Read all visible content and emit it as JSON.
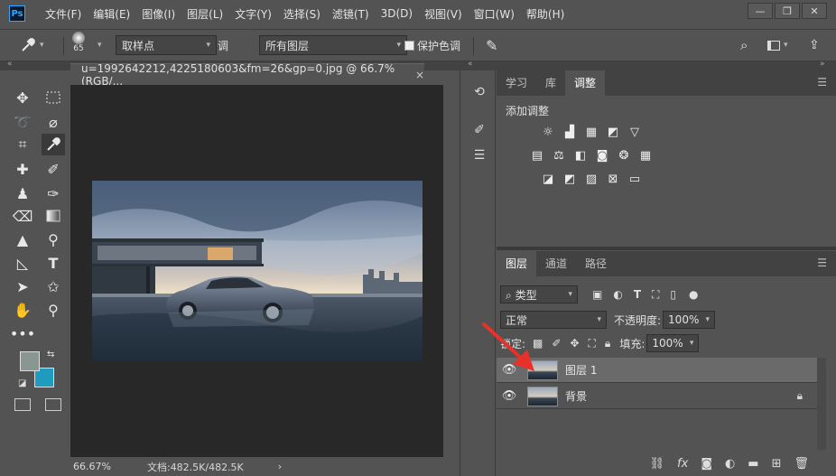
{
  "app": {
    "logo_text": "Ps"
  },
  "menu": [
    "文件(F)",
    "编辑(E)",
    "图像(I)",
    "图层(L)",
    "文字(Y)",
    "选择(S)",
    "滤镜(T)",
    "3D(D)",
    "视图(V)",
    "窗口(W)",
    "帮助(H)"
  ],
  "window_controls": {
    "minimize": "—",
    "restore": "❐",
    "close": "✕"
  },
  "options_bar": {
    "brush_size": "65",
    "sample_label": "取样点",
    "sample_value_tail": "调",
    "layers_select": "所有图层",
    "protect_label": "保护色调"
  },
  "document": {
    "tab_title": "u=1992642212,4225180603&fm=26&gp=0.jpg @ 66.7%(RGB/...",
    "close": "×",
    "zoom": "66.67%",
    "doc_info": "文档:482.5K/482.5K",
    "status_arrow": "›"
  },
  "panels_top": {
    "tabs": [
      "学习",
      "库",
      "调整"
    ],
    "active": "调整",
    "heading": "添加调整"
  },
  "panels_layers": {
    "tabs": [
      "图层",
      "通道",
      "路径"
    ],
    "active": "图层",
    "filter_kind": "类型",
    "blend_mode": "正常",
    "opacity_label": "不透明度:",
    "opacity_value": "100%",
    "lock_label": "锁定:",
    "fill_label": "填充:",
    "fill_value": "100%",
    "layers": [
      {
        "name": "图层 1",
        "selected": true,
        "locked": false
      },
      {
        "name": "背景",
        "selected": false,
        "locked": true
      }
    ]
  },
  "colors": {
    "foreground": "#8a9691",
    "background": "#1f9bbf",
    "annotation_arrow": "#e8312a",
    "ps_accent": "#31a8ff"
  },
  "icons": {
    "toolbar": [
      "move-icon",
      "marquee-icon",
      "lasso-icon",
      "quick-select-icon",
      "crop-icon",
      "eyedropper-icon",
      "healing-icon",
      "brush-icon",
      "stamp-icon",
      "history-brush-icon",
      "eraser-icon",
      "gradient-icon",
      "sharpen-icon",
      "dodge-icon",
      "pen-icon",
      "type-icon",
      "path-select-icon",
      "shape-icon",
      "hand-icon",
      "zoom-icon",
      "more-tools-icon"
    ]
  }
}
